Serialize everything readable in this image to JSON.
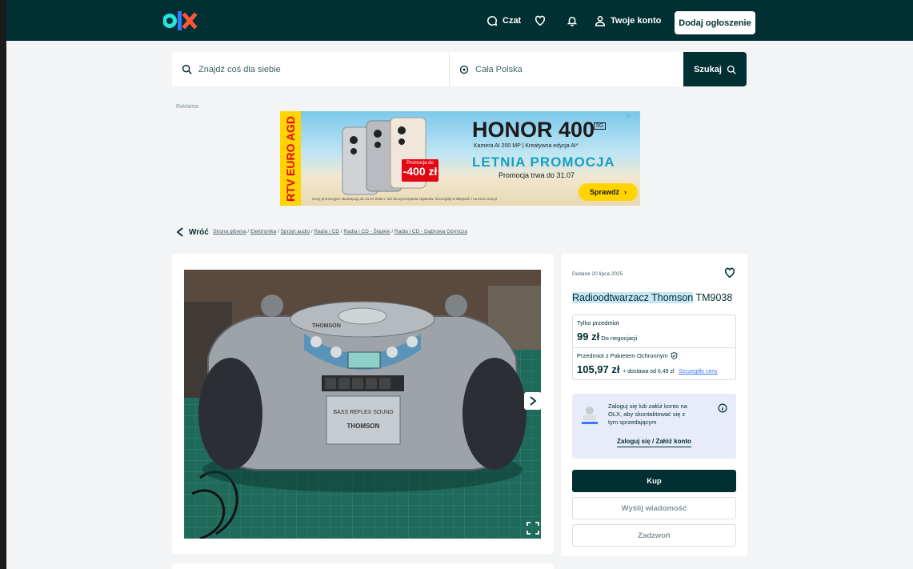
{
  "header": {
    "chat_label": "Czat",
    "account_label": "Twoje konto",
    "add_listing_label": "Dodaj ogłoszenie"
  },
  "search": {
    "query_placeholder": "Znajdź coś dla siebie",
    "location_value": "Cała Polska",
    "button_label": "Szukaj"
  },
  "ad": {
    "label": "Reklama",
    "retailer": "RTV EURO AGD",
    "promo_small": "Promocja do",
    "promo_amount": "-400 zł",
    "headline": "HONOR 400",
    "badge": "5G",
    "subline": "Kamera AI 200 MP | Kreatywna edycja AI*",
    "promo_title": "LETNIA PROMOCJA",
    "promo_dates": "Promocja trwa do 31.07",
    "fine_print": "Ceny promocyjne obowiązują do 31.07.2025 r. lub do wyczerpania zapasów. Szczegóły w sklepach i na euro.com.pl",
    "cta": "Sprawdź",
    "info_icon": "ad-choices-icon"
  },
  "breadcrumb": {
    "back_label": "Wróć",
    "items": [
      "Strona główna",
      "Elektronika",
      "Sprzęt audio",
      "Radia i CD",
      "Radia i CD - Śląskie",
      "Radia i CD - Dąbrowa Górnicza"
    ]
  },
  "listing": {
    "posted": "Dodane 20 lipca 2025",
    "title_highlight": "Radioodtwarzacz Thomson",
    "title_rest": " TM9038",
    "item_only_label": "Tylko przedmiot",
    "item_price": "99 zł",
    "negotiable": "Do negocjacji",
    "protection_label": "Przedmiot z Pakietem Ochronnym",
    "protected_price": "105,97 zł",
    "shipping": "+ dostawa od 6,49 zł",
    "price_details_link": "Szczegóły ceny",
    "login_prompt": "Zaloguj się lub załóż konto na OLX, aby skontaktować się z tym sprzedającym",
    "login_link": "Zaloguj się / Załóż konto",
    "buy_label": "Kup",
    "message_label": "Wyślij wiadomość",
    "call_label": "Zadzwoń"
  },
  "photo": {
    "brand_label": "THOMSON",
    "bass_label": "BASS REFLEX SOUND"
  },
  "colors": {
    "header_bg": "#002f34",
    "accent_link": "#3a77ff",
    "ad_yellow": "#ffd400",
    "ad_red": "#e30613"
  }
}
